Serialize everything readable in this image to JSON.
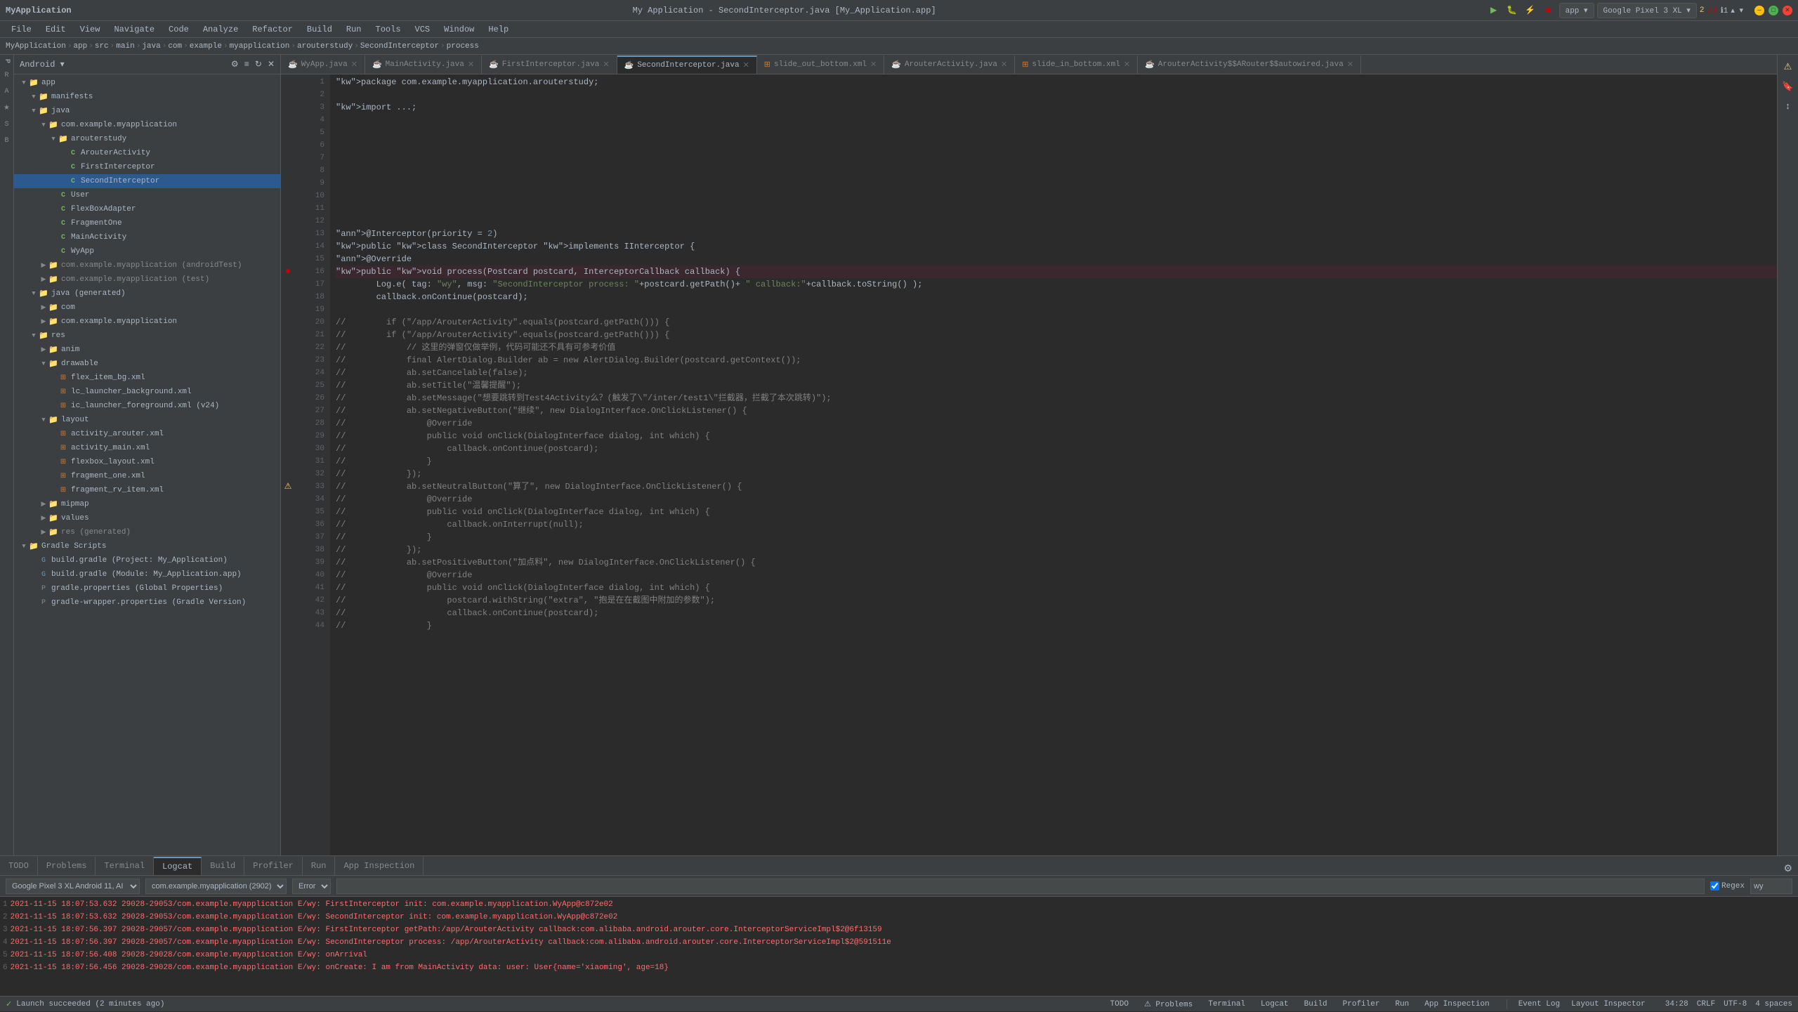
{
  "titleBar": {
    "appName": "MyApplication",
    "title": "My Application - SecondInterceptor.java [My_Application.app]",
    "windowControls": [
      "minimize",
      "maximize",
      "close"
    ]
  },
  "menuBar": {
    "items": [
      "File",
      "Edit",
      "View",
      "Navigate",
      "Code",
      "Analyze",
      "Refactor",
      "Build",
      "Run",
      "Tools",
      "VCS",
      "Window",
      "Help"
    ]
  },
  "breadcrumb": {
    "items": [
      "MyApplication",
      "app",
      "src",
      "main",
      "java",
      "com",
      "example",
      "myapplication",
      "arouterstudy",
      "SecondInterceptor",
      "process"
    ]
  },
  "tabs": {
    "items": [
      {
        "label": "WyApp.java",
        "active": false,
        "closable": true
      },
      {
        "label": "MainActivity.java",
        "active": false,
        "closable": true
      },
      {
        "label": "FirstInterceptor.java",
        "active": false,
        "closable": true
      },
      {
        "label": "SecondInterceptor.java",
        "active": true,
        "closable": true
      },
      {
        "label": "slide_out_bottom.xml",
        "active": false,
        "closable": true
      },
      {
        "label": "ArouterActivity.java",
        "active": false,
        "closable": true
      },
      {
        "label": "slide_in_bottom.xml",
        "active": false,
        "closable": true
      },
      {
        "label": "ArouterActivity$$ARouter$$autowired.java",
        "active": false,
        "closable": true
      }
    ]
  },
  "sidebar": {
    "title": "Android",
    "tree": [
      {
        "label": "app",
        "type": "folder",
        "level": 0,
        "expanded": true,
        "arrow": "▼"
      },
      {
        "label": "manifests",
        "type": "folder",
        "level": 1,
        "expanded": true,
        "arrow": "▼"
      },
      {
        "label": "java",
        "type": "folder",
        "level": 1,
        "expanded": true,
        "arrow": "▼"
      },
      {
        "label": "com.example.myapplication",
        "type": "folder",
        "level": 2,
        "expanded": true,
        "arrow": "▼"
      },
      {
        "label": "arouterstudy",
        "type": "folder",
        "level": 3,
        "expanded": true,
        "arrow": "▼"
      },
      {
        "label": "ArouterActivity",
        "type": "class",
        "level": 4,
        "arrow": ""
      },
      {
        "label": "FirstInterceptor",
        "type": "class",
        "level": 4,
        "arrow": ""
      },
      {
        "label": "SecondInterceptor",
        "type": "class",
        "level": 4,
        "arrow": "",
        "selected": true
      },
      {
        "label": "User",
        "type": "class",
        "level": 3,
        "arrow": ""
      },
      {
        "label": "FlexBoxAdapter",
        "type": "class",
        "level": 3,
        "arrow": ""
      },
      {
        "label": "FragmentOne",
        "type": "class",
        "level": 3,
        "arrow": ""
      },
      {
        "label": "MainActivity",
        "type": "class",
        "level": 3,
        "arrow": ""
      },
      {
        "label": "WyApp",
        "type": "class",
        "level": 3,
        "arrow": ""
      },
      {
        "label": "com.example.myapplication (androidTest)",
        "type": "folder-gray",
        "level": 2,
        "expanded": false,
        "arrow": "▶"
      },
      {
        "label": "com.example.myapplication (test)",
        "type": "folder-gray",
        "level": 2,
        "expanded": false,
        "arrow": "▶"
      },
      {
        "label": "java (generated)",
        "type": "folder",
        "level": 1,
        "expanded": true,
        "arrow": "▼"
      },
      {
        "label": "com",
        "type": "folder",
        "level": 2,
        "expanded": false,
        "arrow": "▶"
      },
      {
        "label": "com.example.myapplication",
        "type": "folder",
        "level": 2,
        "expanded": false,
        "arrow": "▶"
      },
      {
        "label": "res",
        "type": "folder",
        "level": 1,
        "expanded": true,
        "arrow": "▼"
      },
      {
        "label": "anim",
        "type": "folder",
        "level": 2,
        "expanded": false,
        "arrow": "▶"
      },
      {
        "label": "drawable",
        "type": "folder",
        "level": 2,
        "expanded": true,
        "arrow": "▼"
      },
      {
        "label": "flex_item_bg.xml",
        "type": "xml",
        "level": 3,
        "arrow": ""
      },
      {
        "label": "lc_launcher_background.xml",
        "type": "xml",
        "level": 3,
        "arrow": ""
      },
      {
        "label": "ic_launcher_foreground.xml (v24)",
        "type": "xml",
        "level": 3,
        "arrow": ""
      },
      {
        "label": "layout",
        "type": "folder",
        "level": 2,
        "expanded": true,
        "arrow": "▼"
      },
      {
        "label": "activity_arouter.xml",
        "type": "xml",
        "level": 3,
        "arrow": ""
      },
      {
        "label": "activity_main.xml",
        "type": "xml",
        "level": 3,
        "arrow": ""
      },
      {
        "label": "flexbox_layout.xml",
        "type": "xml",
        "level": 3,
        "arrow": ""
      },
      {
        "label": "fragment_one.xml",
        "type": "xml",
        "level": 3,
        "arrow": ""
      },
      {
        "label": "fragment_rv_item.xml",
        "type": "xml",
        "level": 3,
        "arrow": ""
      },
      {
        "label": "mipmap",
        "type": "folder",
        "level": 2,
        "expanded": false,
        "arrow": "▶"
      },
      {
        "label": "values",
        "type": "folder",
        "level": 2,
        "expanded": false,
        "arrow": "▶"
      },
      {
        "label": "res (generated)",
        "type": "folder-gray",
        "level": 2,
        "expanded": false,
        "arrow": "▶"
      },
      {
        "label": "Gradle Scripts",
        "type": "folder",
        "level": 0,
        "expanded": true,
        "arrow": "▼"
      },
      {
        "label": "build.gradle (Project: My_Application)",
        "type": "gradle",
        "level": 1,
        "arrow": ""
      },
      {
        "label": "build.gradle (Module: My_Application.app)",
        "type": "gradle",
        "level": 1,
        "arrow": ""
      },
      {
        "label": "gradle.properties (Global Properties)",
        "type": "props",
        "level": 1,
        "arrow": ""
      },
      {
        "label": "gradle-wrapper.properties (Gradle Version)",
        "type": "props",
        "level": 1,
        "arrow": ""
      }
    ]
  },
  "code": {
    "fileName": "SecondInterceptor.java",
    "lines": [
      {
        "num": 1,
        "content": "package com.example.myapplication.arouterstudy;"
      },
      {
        "num": 2,
        "content": ""
      },
      {
        "num": 3,
        "content": "import ...;"
      },
      {
        "num": 4,
        "content": ""
      },
      {
        "num": 5,
        "content": ""
      },
      {
        "num": 6,
        "content": ""
      },
      {
        "num": 7,
        "content": ""
      },
      {
        "num": 8,
        "content": ""
      },
      {
        "num": 9,
        "content": ""
      },
      {
        "num": 10,
        "content": ""
      },
      {
        "num": 11,
        "content": ""
      },
      {
        "num": 12,
        "content": ""
      },
      {
        "num": 13,
        "content": "@Interceptor(priority = 2)"
      },
      {
        "num": 14,
        "content": "public class SecondInterceptor implements IInterceptor {"
      },
      {
        "num": 15,
        "content": "    @Override"
      },
      {
        "num": 16,
        "content": "    public void process(Postcard postcard, InterceptorCallback callback) {",
        "hasBreakpoint": true
      },
      {
        "num": 17,
        "content": "        Log.e( tag: \"wy\", msg: \"SecondInterceptor process: \"+postcard.getPath()+ \" callback:\"+callback.toString() );"
      },
      {
        "num": 18,
        "content": "        callback.onContinue(postcard);"
      },
      {
        "num": 19,
        "content": ""
      },
      {
        "num": 20,
        "content": "//        if (\"/app/ArouterActivity\".equals(postcard.getPath())) {",
        "isComment": true
      },
      {
        "num": 21,
        "content": "//        if (\"/app/ArouterActivity\".equals(postcard.getPath())) {",
        "isComment": true
      },
      {
        "num": 22,
        "content": "//            // 这里的弹窗仅做举例，代码可能还不具有可参考价值",
        "isComment": true
      },
      {
        "num": 23,
        "content": "//            final AlertDialog.Builder ab = new AlertDialog.Builder(postcard.getContext());",
        "isComment": true
      },
      {
        "num": 24,
        "content": "//            ab.setCancelable(false);",
        "isComment": true
      },
      {
        "num": 25,
        "content": "//            ab.setTitle(\"温馨提醒\");",
        "isComment": true
      },
      {
        "num": 26,
        "content": "//            ab.setMessage(\"想要跳转到Test4Activity么？(触发了\\\"/inter/test1\\\"拦截器，拦截了本次跳转)\");",
        "isComment": true
      },
      {
        "num": 27,
        "content": "//            ab.setNegativeButton(\"继续\", new DialogInterface.OnClickListener() {",
        "isComment": true
      },
      {
        "num": 28,
        "content": "//                @Override",
        "isComment": true
      },
      {
        "num": 29,
        "content": "//                public void onClick(DialogInterface dialog, int which) {",
        "isComment": true
      },
      {
        "num": 30,
        "content": "//                    callback.onContinue(postcard);",
        "isComment": true
      },
      {
        "num": 31,
        "content": "//                }",
        "isComment": true
      },
      {
        "num": 32,
        "content": "//            });",
        "isComment": true
      },
      {
        "num": 33,
        "content": "//            ab.setNeutralButton(\"算了\", new DialogInterface.OnClickListener() {",
        "isComment": true,
        "hasWarning": true
      },
      {
        "num": 34,
        "content": "//                @Override",
        "isComment": true
      },
      {
        "num": 35,
        "content": "//                public void onClick(DialogInterface dialog, int which) {",
        "isComment": true
      },
      {
        "num": 36,
        "content": "//                    callback.onInterrupt(null);",
        "isComment": true
      },
      {
        "num": 37,
        "content": "//                }",
        "isComment": true
      },
      {
        "num": 38,
        "content": "//            });",
        "isComment": true
      },
      {
        "num": 39,
        "content": "//            ab.setPositiveButton(\"加点料\", new DialogInterface.OnClickListener() {",
        "isComment": true
      },
      {
        "num": 40,
        "content": "//                @Override",
        "isComment": true
      },
      {
        "num": 41,
        "content": "//                public void onClick(DialogInterface dialog, int which) {",
        "isComment": true
      },
      {
        "num": 42,
        "content": "//                    postcard.withString(\"extra\", \"抱是在在截图中附加的参数\");",
        "isComment": true
      },
      {
        "num": 43,
        "content": "//                    callback.onContinue(postcard);",
        "isComment": true
      },
      {
        "num": 44,
        "content": "//                }",
        "isComment": true
      }
    ]
  },
  "logcat": {
    "device": "Google Pixel 3 XL Android 11, AI",
    "package": "com.example.myapplication (2902)",
    "level": "Error",
    "searchPlaceholder": "",
    "regexLabel": "Regex",
    "filterText": "wy",
    "logs": [
      {
        "text": "2021-11-15 18:07:53.632 29028-29053/com.example.myapplication E/wy: FirstInterceptor init: com.example.myapplication.WyApp@c872e02",
        "type": "error"
      },
      {
        "text": "2021-11-15 18:07:53.632 29028-29053/com.example.myapplication E/wy: SecondInterceptor init: com.example.myapplication.WyApp@c872e02",
        "type": "error"
      },
      {
        "text": "2021-11-15 18:07:56.397 29028-29057/com.example.myapplication E/wy: FirstInterceptor  getPath:/app/ArouterActivity callback:com.alibaba.android.arouter.core.InterceptorServiceImpl$2@6f13159",
        "type": "error"
      },
      {
        "text": "2021-11-15 18:07:56.397 29028-29057/com.example.myapplication E/wy: SecondInterceptor process: /app/ArouterActivity callback:com.alibaba.android.arouter.core.InterceptorServiceImpl$2@591511e",
        "type": "error"
      },
      {
        "text": "2021-11-15 18:07:56.408 29028-29028/com.example.myapplication E/wy: onArrival",
        "type": "error"
      },
      {
        "text": "2021-11-15 18:07:56.456 29028-29028/com.example.myapplication E/wy: onCreate: I am from MainActivity data:  user: User{name='xiaoming', age=18}",
        "type": "error"
      }
    ]
  },
  "bottomTabs": [
    "TODO",
    "Problems",
    "Terminal",
    "Logcat",
    "Build",
    "Profiler",
    "Run",
    "App Inspection"
  ],
  "statusBar": {
    "launchStatus": "Launch succeeded (2 minutes ago)",
    "cursorPos": "34:28",
    "encoding": "UTF-8",
    "lineEnding": "CRLF",
    "indent": "4 spaces",
    "bottomRight": {
      "eventLog": "Event Log",
      "layoutInspector": "Layout Inspector"
    },
    "notifications": {
      "warnings": "2",
      "errors": "1",
      "infos": "1"
    }
  }
}
